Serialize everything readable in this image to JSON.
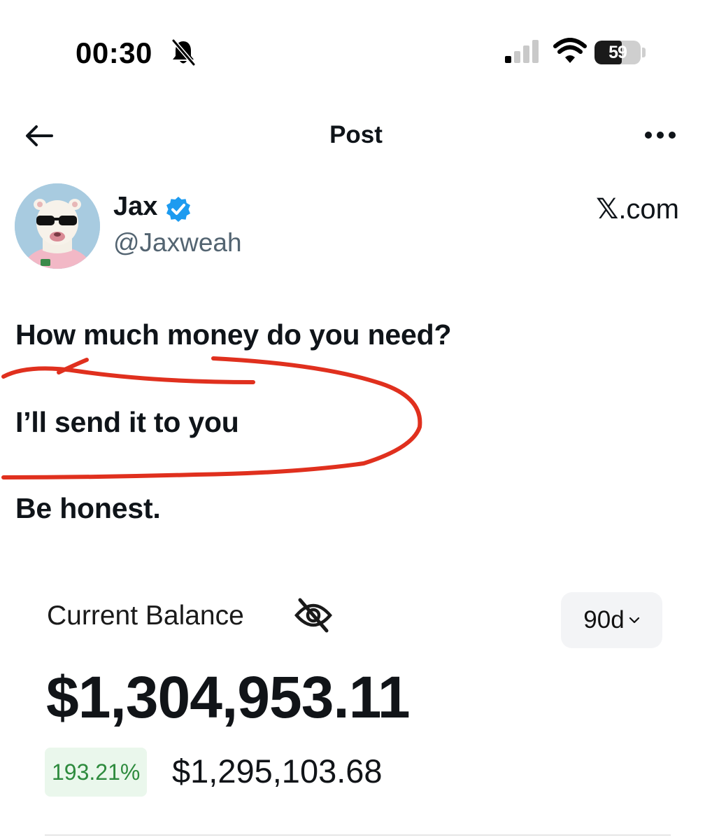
{
  "status_bar": {
    "time": "00:30",
    "battery_level": "59",
    "battery_fraction": 0.59
  },
  "nav": {
    "title": "Post"
  },
  "author": {
    "name": "Jax",
    "handle": "@Jaxweah",
    "verified": true,
    "source_brand": "X.com",
    "source_brand_mark": "𝕏",
    "source_brand_suffix": ".com"
  },
  "post": {
    "lines": [
      "How much money do you need?",
      "I’ll send it to you",
      "Be honest."
    ]
  },
  "embedded_card": {
    "balance_label": "Current Balance",
    "period": "90d",
    "balance_amount": "$1,304,953.11",
    "change_percent": "193.21%",
    "change_amount": "$1,295,103.68"
  },
  "colors": {
    "text_primary": "#0f1419",
    "text_secondary": "#536471",
    "verified_blue": "#1d9bf0",
    "annotation_red": "#e0301e",
    "gain_green": "#2e8b3e",
    "gain_badge_bg": "#eaf7ec"
  },
  "icons": [
    "bell-slash-icon",
    "signal-icon",
    "wifi-icon",
    "battery-icon",
    "back-arrow-icon",
    "more-icon",
    "verified-badge-icon",
    "eye-slash-icon",
    "chevron-down-icon"
  ]
}
